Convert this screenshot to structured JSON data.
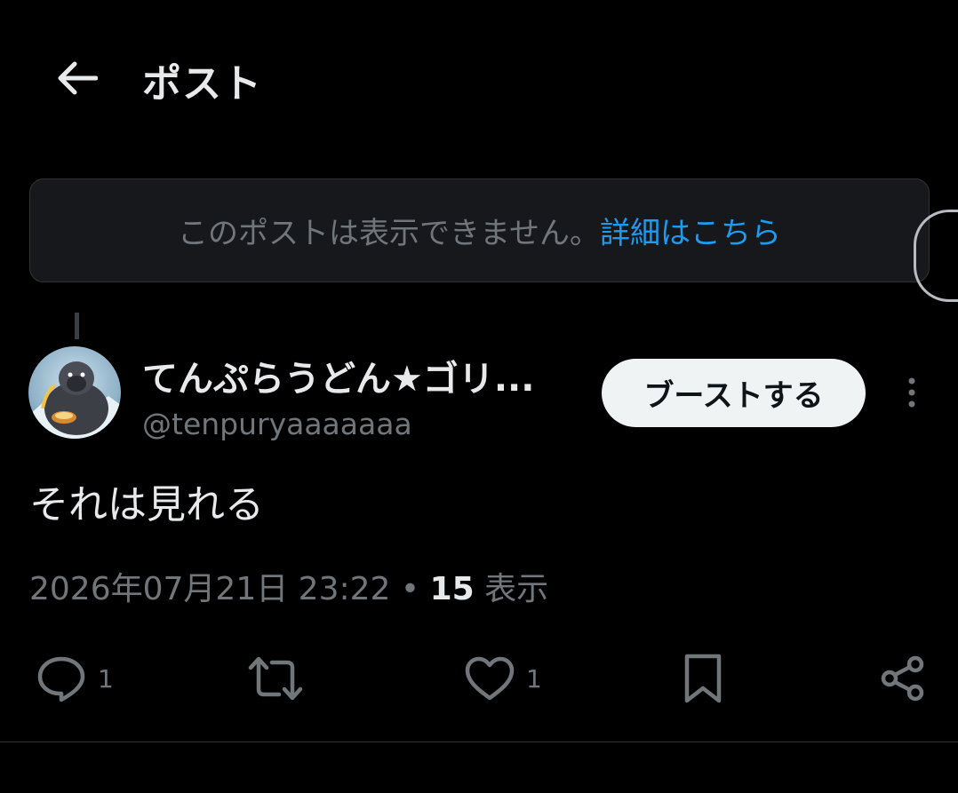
{
  "header": {
    "title": "ポスト",
    "back_icon": "arrow-left-icon"
  },
  "notice": {
    "text": "このポストは表示できません。",
    "link_label": "詳細はこちら"
  },
  "post": {
    "author": {
      "display_name": "てんぷらうどん★ゴリ...",
      "handle": "@tenpuryaaaaaaa",
      "avatar_icon": "gorilla-avatar"
    },
    "boost_label": "ブーストする",
    "more_icon": "vertical-ellipsis-icon",
    "text": "それは見れる",
    "timestamp": "2026年07月21日 23:22",
    "separator": " • ",
    "views_count": "15",
    "views_label": " 表示"
  },
  "actions": {
    "reply_count": "1",
    "like_count": "1"
  },
  "colors": {
    "background": "#000000",
    "text_primary": "#e7e9ea",
    "text_secondary": "#71767b",
    "link": "#1d9bf0",
    "notice_bg": "#16181c",
    "button_bg": "#eff3f4"
  }
}
